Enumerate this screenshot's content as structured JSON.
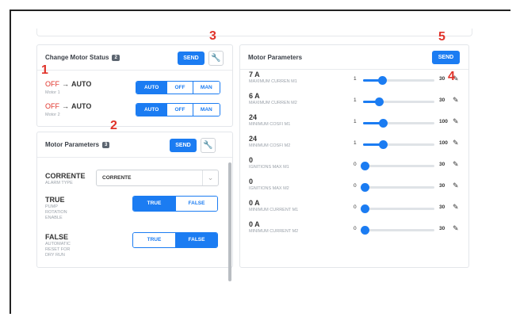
{
  "markers": [
    "1",
    "2",
    "3",
    "4",
    "5"
  ],
  "motor_status": {
    "title": "Change Motor Status",
    "badge": "2",
    "send_label": "SEND",
    "wrench_icon": "wrench-icon",
    "rows": [
      {
        "state": "OFF",
        "arrow": "→",
        "target": "AUTO",
        "sub": "Motor 1",
        "options": [
          "AUTO",
          "OFF",
          "MAN"
        ],
        "selected": "AUTO"
      },
      {
        "state": "OFF",
        "arrow": "→",
        "target": "AUTO",
        "sub": "Motor 2",
        "options": [
          "AUTO",
          "OFF",
          "MAN"
        ],
        "selected": "AUTO"
      }
    ]
  },
  "motor_params_left": {
    "title": "Motor Parameters",
    "badge": "3",
    "send_label": "SEND",
    "wrench_icon": "wrench-icon",
    "alarm": {
      "label": "CORRENTE",
      "sub": "ALARM TYPE",
      "select_value": "CORRENTE",
      "chevron_icon": "chevron-down-icon"
    },
    "pump": {
      "label": "TRUE",
      "sub": [
        "PUMP",
        "ROTATION",
        "ENABLE"
      ],
      "options": [
        "TRUE",
        "FALSE"
      ],
      "selected": "TRUE"
    },
    "reset": {
      "label": "FALSE",
      "sub": [
        "AUTOMATIC",
        "RESET FOR",
        "DRY RUN"
      ],
      "options": [
        "TRUE",
        "FALSE"
      ],
      "selected": "FALSE"
    }
  },
  "motor_params_right": {
    "title": "Motor Parameters",
    "send_label": "SEND",
    "edit_icon": "edit-icon",
    "items": [
      {
        "value": "7 A",
        "name": "MAXIMUM CURREN M1",
        "min": "1",
        "max": "30",
        "level": 0.24
      },
      {
        "value": "6 A",
        "name": "MAXIMUM CURREN M2",
        "min": "1",
        "max": "30",
        "level": 0.2
      },
      {
        "value": "24",
        "name": "MINIMUM COSFI M1",
        "min": "1",
        "max": "100",
        "level": 0.25
      },
      {
        "value": "24",
        "name": "MINIMUM COSFI M2",
        "min": "1",
        "max": "100",
        "level": 0.25
      },
      {
        "value": "0",
        "name": "IGNITIONS MAX M1",
        "min": "0",
        "max": "30",
        "level": 0.0
      },
      {
        "value": "0",
        "name": "IGNITIONS MAX M2",
        "min": "0",
        "max": "30",
        "level": 0.0
      },
      {
        "value": "0 A",
        "name": "MINIMUM CURRENT M1",
        "min": "0",
        "max": "30",
        "level": 0.0
      },
      {
        "value": "0 A",
        "name": "MINIMUM CURRENT M2",
        "min": "0",
        "max": "30",
        "level": 0.0
      }
    ]
  },
  "colors": {
    "accent": "#1b7cf2",
    "off": "#e0332a",
    "marker": "#e0332a"
  }
}
